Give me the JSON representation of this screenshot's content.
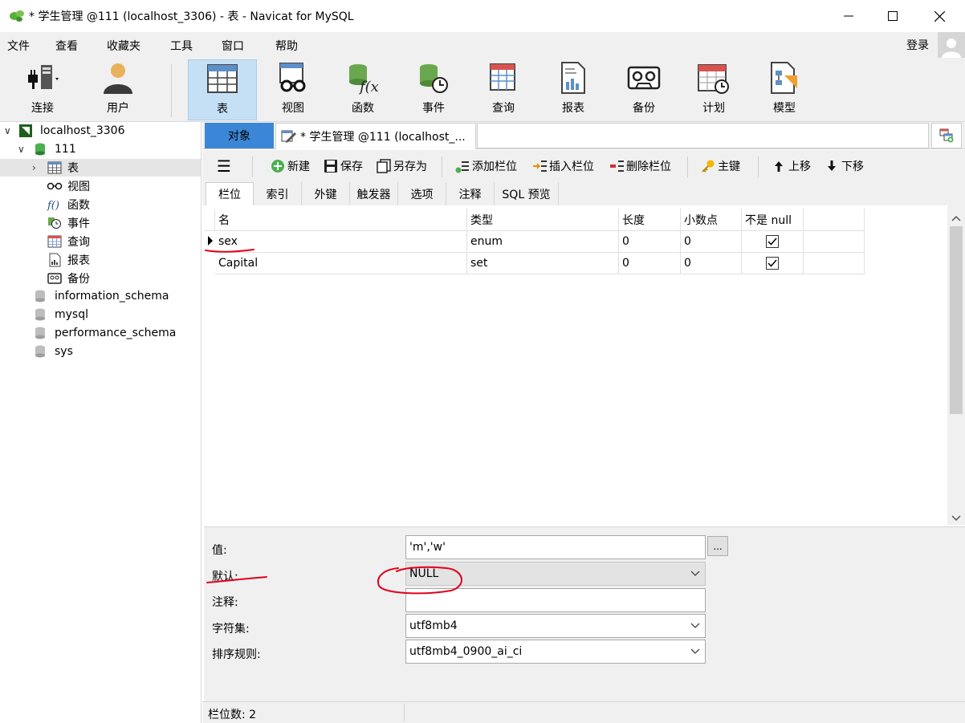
{
  "window": {
    "title": "* 学生管理 @111 (localhost_3306) - 表 - Navicat for MySQL",
    "minimize_glyph": "—",
    "maximize_glyph": "☐",
    "close_glyph": "✕"
  },
  "menu": {
    "items": [
      "文件",
      "查看",
      "收藏夹",
      "工具",
      "窗口",
      "帮助"
    ],
    "login": "登录"
  },
  "toolbar": {
    "tools": [
      {
        "label": "连接",
        "icon": "connection-plug-icon"
      },
      {
        "label": "用户",
        "icon": "user-icon"
      },
      {
        "label": "表",
        "icon": "table-icon"
      },
      {
        "label": "视图",
        "icon": "view-glasses-icon"
      },
      {
        "label": "函数",
        "icon": "function-icon"
      },
      {
        "label": "事件",
        "icon": "event-clock-icon"
      },
      {
        "label": "查询",
        "icon": "query-icon"
      },
      {
        "label": "报表",
        "icon": "report-icon"
      },
      {
        "label": "备份",
        "icon": "backup-tape-icon"
      },
      {
        "label": "计划",
        "icon": "schedule-calendar-icon"
      },
      {
        "label": "模型",
        "icon": "model-icon"
      }
    ],
    "active": "表"
  },
  "sidebar": {
    "connection": "localhost_3306",
    "database": "111",
    "nodes": [
      "表",
      "视图",
      "函数",
      "事件",
      "查询",
      "报表",
      "备份"
    ],
    "other_databases": [
      "information_schema",
      "mysql",
      "performance_schema",
      "sys"
    ],
    "selected": "表"
  },
  "tabs": {
    "objects": "对象",
    "current": "* 学生管理 @111 (localhost_..."
  },
  "editor_toolbar": {
    "menu_glyph": "☰",
    "new": "新建",
    "save": "保存",
    "save_as": "另存为",
    "add_field": "添加栏位",
    "insert_field": "插入栏位",
    "delete_field": "删除栏位",
    "primary_key": "主键",
    "move_up": "上移",
    "move_down": "下移"
  },
  "subtabs": [
    "栏位",
    "索引",
    "外键",
    "触发器",
    "选项",
    "注释",
    "SQL 预览"
  ],
  "grid": {
    "columns": [
      "名",
      "类型",
      "长度",
      "小数点",
      "不是 null"
    ],
    "rows": [
      {
        "name": "sex",
        "type": "enum",
        "length": "0",
        "decimals": "0",
        "not_null": true
      },
      {
        "name": "Capital",
        "type": "set",
        "length": "0",
        "decimals": "0",
        "not_null": true
      }
    ]
  },
  "properties": {
    "value_label": "值:",
    "value": "'m','w'",
    "ellipsis": "...",
    "default_label": "默认:",
    "default": "NULL",
    "comment_label": "注释:",
    "comment": "",
    "charset_label": "字符集:",
    "charset": "utf8mb4",
    "collation_label": "排序规则:",
    "collation": "utf8mb4_0900_ai_ci"
  },
  "status": {
    "field_count": "栏位数: 2"
  },
  "colors": {
    "accent": "#3b86d6",
    "active_tool": "#c5e0f5",
    "annotation": "#e3001b"
  }
}
